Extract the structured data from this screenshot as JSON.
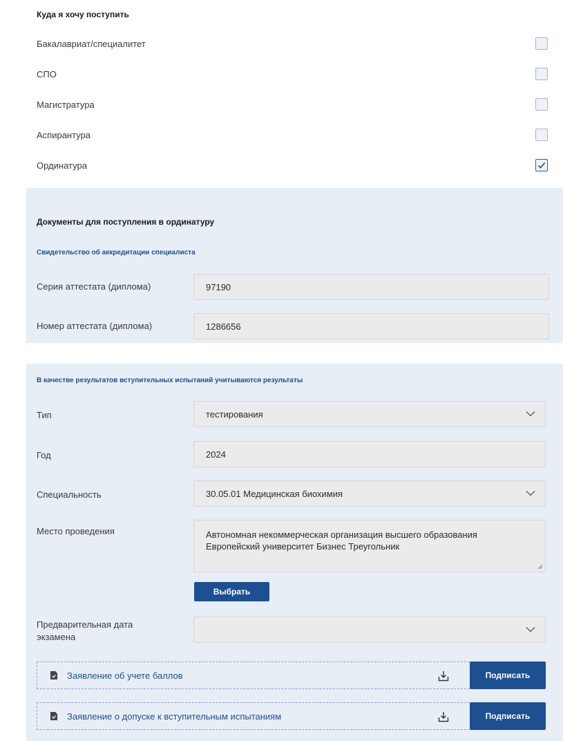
{
  "want_section": {
    "title": "Куда я хочу поступить",
    "options": [
      {
        "label": "Бакалавриат/специалитет",
        "checked": false
      },
      {
        "label": "СПО",
        "checked": false
      },
      {
        "label": "Магистратура",
        "checked": false
      },
      {
        "label": "Аспирантура",
        "checked": false
      },
      {
        "label": "Ординатура",
        "checked": true
      }
    ]
  },
  "documents_section": {
    "title": "Документы для поступления в ординатуру",
    "subtitle": "Свидетельство об аккредитации специалиста",
    "series_label": "Серия аттестата (диплома)",
    "series_value": "97190",
    "number_label": "Номер аттестата (диплома)",
    "number_value": "1286656"
  },
  "results_section": {
    "subtitle": "В качестве результатов вступительных испытаний учитываются результаты",
    "type_label": "Тип",
    "type_value": "тестирования",
    "year_label": "Год",
    "year_value": "2024",
    "specialty_label": "Специальность",
    "specialty_value": "30.05.01 Медицинская биохимия",
    "place_label": "Место проведения",
    "place_line1": "Автономная некоммерческая организация высшего образования",
    "place_line2": "Европейский университет Бизнес Треугольник",
    "choose_button": "Выбрать",
    "exam_date_label_line1": "Предварительная дата",
    "exam_date_label_line2": "экзамена",
    "exam_date_value": ""
  },
  "statements": [
    {
      "label": "Заявление об учете баллов",
      "sign_button": "Подписать"
    },
    {
      "label": "Заявление о допуске к вступительным испытаниям",
      "sign_button": "Подписать"
    }
  ],
  "colors": {
    "accent": "#1d4f91",
    "panel_bg": "#e8eef6",
    "field_bg": "#ebebeb"
  }
}
